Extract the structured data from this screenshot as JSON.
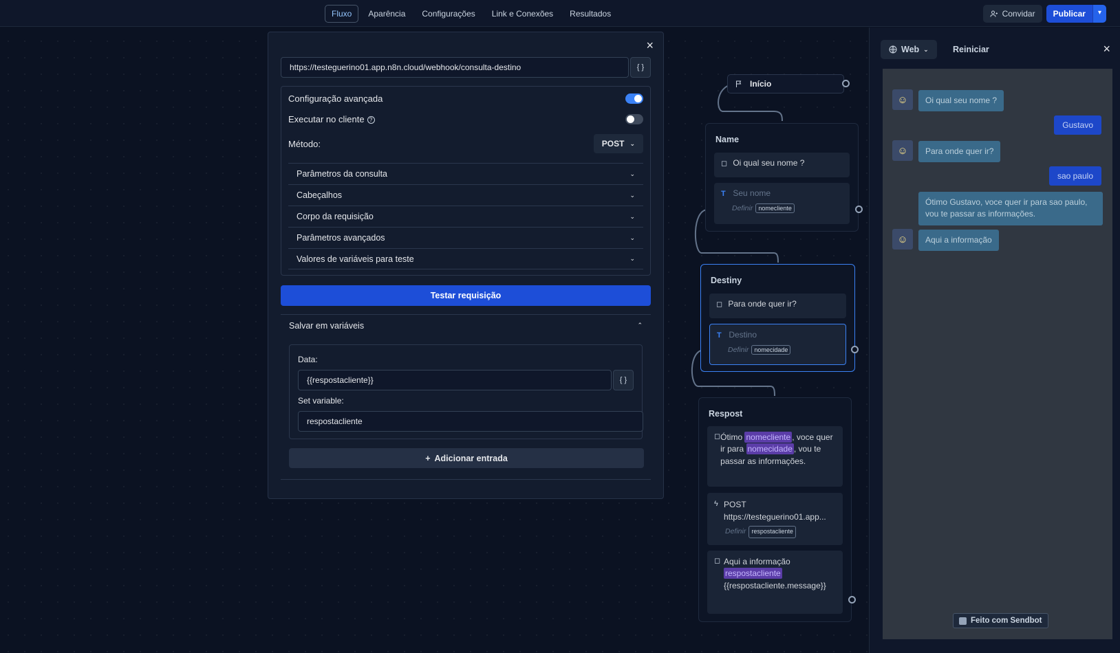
{
  "topbar": {
    "tabs": [
      "Fluxo",
      "Aparência",
      "Configurações",
      "Link e Conexões",
      "Resultados"
    ],
    "invite_label": "Convidar",
    "publish_label": "Publicar"
  },
  "modal": {
    "url_value": "https://testeguerino01.app.n8n.cloud/webhook/consulta-destino",
    "var_button": "{ }",
    "advanced_config_label": "Configuração avançada",
    "advanced_config_on": true,
    "execute_client_label": "Executar no cliente",
    "execute_client_on": false,
    "method_label": "Método:",
    "method_value": "POST",
    "sections": [
      "Parâmetros da consulta",
      "Cabeçalhos",
      "Corpo da requisição",
      "Parâmetros avançados",
      "Valores de variáveis para teste"
    ],
    "test_button": "Testar requisição",
    "save_vars_label": "Salvar em variáveis",
    "data_label": "Data:",
    "data_value": "{{respostacliente}}",
    "set_variable_label": "Set variable:",
    "set_variable_value": "respostacliente",
    "add_entry_label": "Adicionar entrada"
  },
  "flow": {
    "start_label": "Início",
    "groups": [
      {
        "title": "Name",
        "text_block": "Oi qual seu nome ?",
        "input_placeholder": "Seu nome",
        "set_label": "Definir",
        "var": "nomecliente"
      },
      {
        "title": "Destiny",
        "text_block": "Para onde quer ir?",
        "input_placeholder": "Destino",
        "set_label": "Definir",
        "var": "nomecidade"
      },
      {
        "title": "Respost",
        "msg_pre": "Ótimo ",
        "msg_var1": "nomecliente",
        "msg_mid": ", voce quer ir para ",
        "msg_var2": "nomecidade",
        "msg_post": ", vou te passar as informações.",
        "webhook_method": "POST",
        "webhook_url": "https://testeguerino01.app...",
        "webhook_set_label": "Definir",
        "webhook_var": "respostacliente",
        "info_text": "Aqui a informação",
        "info_var": "respostacliente",
        "info_expr": "{{respostacliente.message}}"
      }
    ]
  },
  "preview": {
    "web_label": "Web",
    "restart_label": "Reiniciar",
    "messages": [
      {
        "from": "bot",
        "text": "Oi qual seu nome ?"
      },
      {
        "from": "user",
        "text": "Gustavo"
      },
      {
        "from": "bot",
        "text": "Para onde quer ir?"
      },
      {
        "from": "user",
        "text": "sao paulo"
      },
      {
        "from": "bot",
        "text": "Ótimo Gustavo, voce quer ir para sao paulo, vou te passar as informações."
      },
      {
        "from": "bot",
        "text": "Aqui a informação"
      }
    ],
    "badge": "Feito com Sendbot"
  },
  "colors": {
    "accent": "#1d4ed8",
    "background": "#0b1222",
    "variable_highlight": "#5b3da8"
  }
}
